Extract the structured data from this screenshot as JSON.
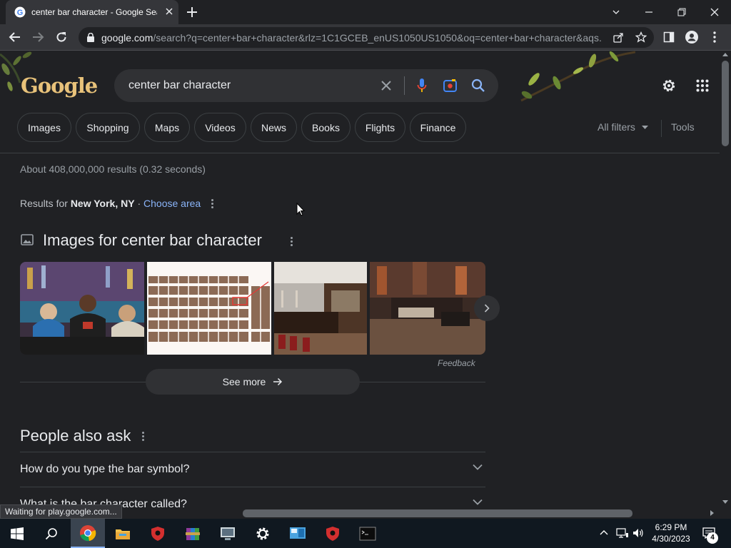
{
  "browser": {
    "tab_title": "center bar character - Google Search",
    "url_host": "google.com",
    "url_path": "/search?q=center+bar+character&rlz=1C1GCEB_enUS1050US1050&oq=center+bar+character&aqs..."
  },
  "search": {
    "logo": "Google",
    "query": "center bar character"
  },
  "filters": {
    "chips": [
      "Images",
      "Shopping",
      "Maps",
      "Videos",
      "News",
      "Books",
      "Flights",
      "Finance"
    ],
    "all_filters": "All filters",
    "tools": "Tools"
  },
  "results": {
    "stats": "About 408,000,000 results (0.32 seconds)",
    "location_prefix": "Results for",
    "location": "New York, NY",
    "location_sep": "·",
    "choose_area": "Choose area"
  },
  "images_block": {
    "heading": "Images for center bar character",
    "feedback": "Feedback",
    "see_more": "See more"
  },
  "paa": {
    "heading": "People also ask",
    "questions": [
      "How do you type the bar symbol?",
      "What is the bar character called?"
    ]
  },
  "status": "Waiting for play.google.com...",
  "taskbar": {
    "time": "6:29 PM",
    "date": "4/30/2023",
    "notifications": "4"
  },
  "colors": {
    "page_bg": "#202124",
    "chrome_bg": "#35363a",
    "link": "#8ab4f8",
    "muted": "#9aa0a6"
  }
}
